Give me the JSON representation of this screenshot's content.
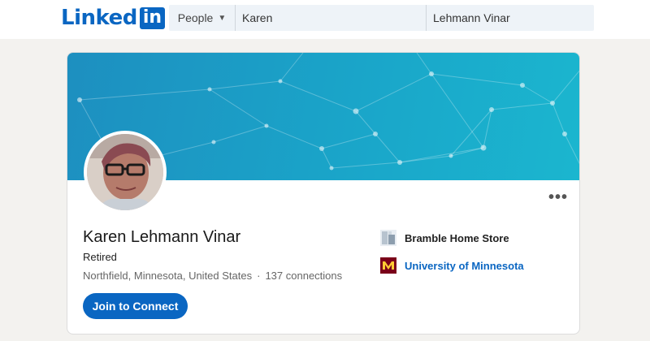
{
  "header": {
    "logo_text": "Linked",
    "logo_badge": "in",
    "brand_color": "#0a66c2",
    "search": {
      "filter_label": "People",
      "first_name_value": "Karen",
      "last_name_value": "Lehmann Vinar"
    }
  },
  "profile": {
    "name": "Karen Lehmann Vinar",
    "headline": "Retired",
    "location": "Northfield, Minnesota, United States",
    "separator": "·",
    "connections": "137 connections",
    "connect_button": "Join to Connect",
    "more_icon": "more-horizontal-icon",
    "experience": [
      {
        "label": "Bramble Home Store",
        "icon": "company-logo-icon"
      },
      {
        "label": "University of Minnesota",
        "icon": "university-logo-icon"
      }
    ]
  }
}
